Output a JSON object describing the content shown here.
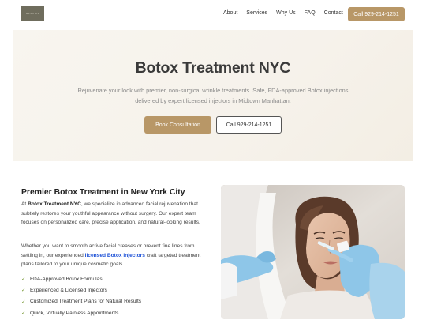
{
  "header": {
    "logo_text": "BOTOX NYC",
    "nav": [
      "About",
      "Services",
      "Why Us",
      "FAQ",
      "Contact"
    ],
    "call_button": "Call 929-214-1251"
  },
  "hero": {
    "title": "Botox Treatment NYC",
    "subtitle": "Rejuvenate your look with premier, non-surgical wrinkle treatments. Safe, FDA-approved Botox injections delivered by expert licensed injectors in Midtown Manhattan.",
    "primary_button": "Book Consultation",
    "secondary_button": "Call 929-214-1251"
  },
  "content": {
    "title": "Premier Botox Treatment in New York City",
    "p1_prefix": "At ",
    "p1_bold": "Botox Treatment NYC",
    "p1_rest": ", we specialize in advanced facial rejuvenation that subtlely restores your youthful appearance without surgery. Our expert team focuses on personalized care, precise application, and natural-looking results.",
    "p2_prefix": "Whether you want to smooth active facial creases or prevent fine lines from settling in, our experienced ",
    "p2_link": "licensed Botox injectors",
    "p2_rest": " craft targeted treatment plans tailored to your unique cosmetic goals.",
    "checklist": [
      "FDA-Approved Botox Formulas",
      "Experienced & Licensed Injectors",
      "Customized Treatment Plans for Natural Results",
      "Quick, Virtually Painless Appointments"
    ],
    "check_glyph": "✓",
    "image": "woman-receiving-botox-injection-photo"
  },
  "colors": {
    "accent": "#b89767",
    "hero_bg": "#f7f3ec",
    "link": "#1a4fd6",
    "check": "#7a9a3a"
  }
}
